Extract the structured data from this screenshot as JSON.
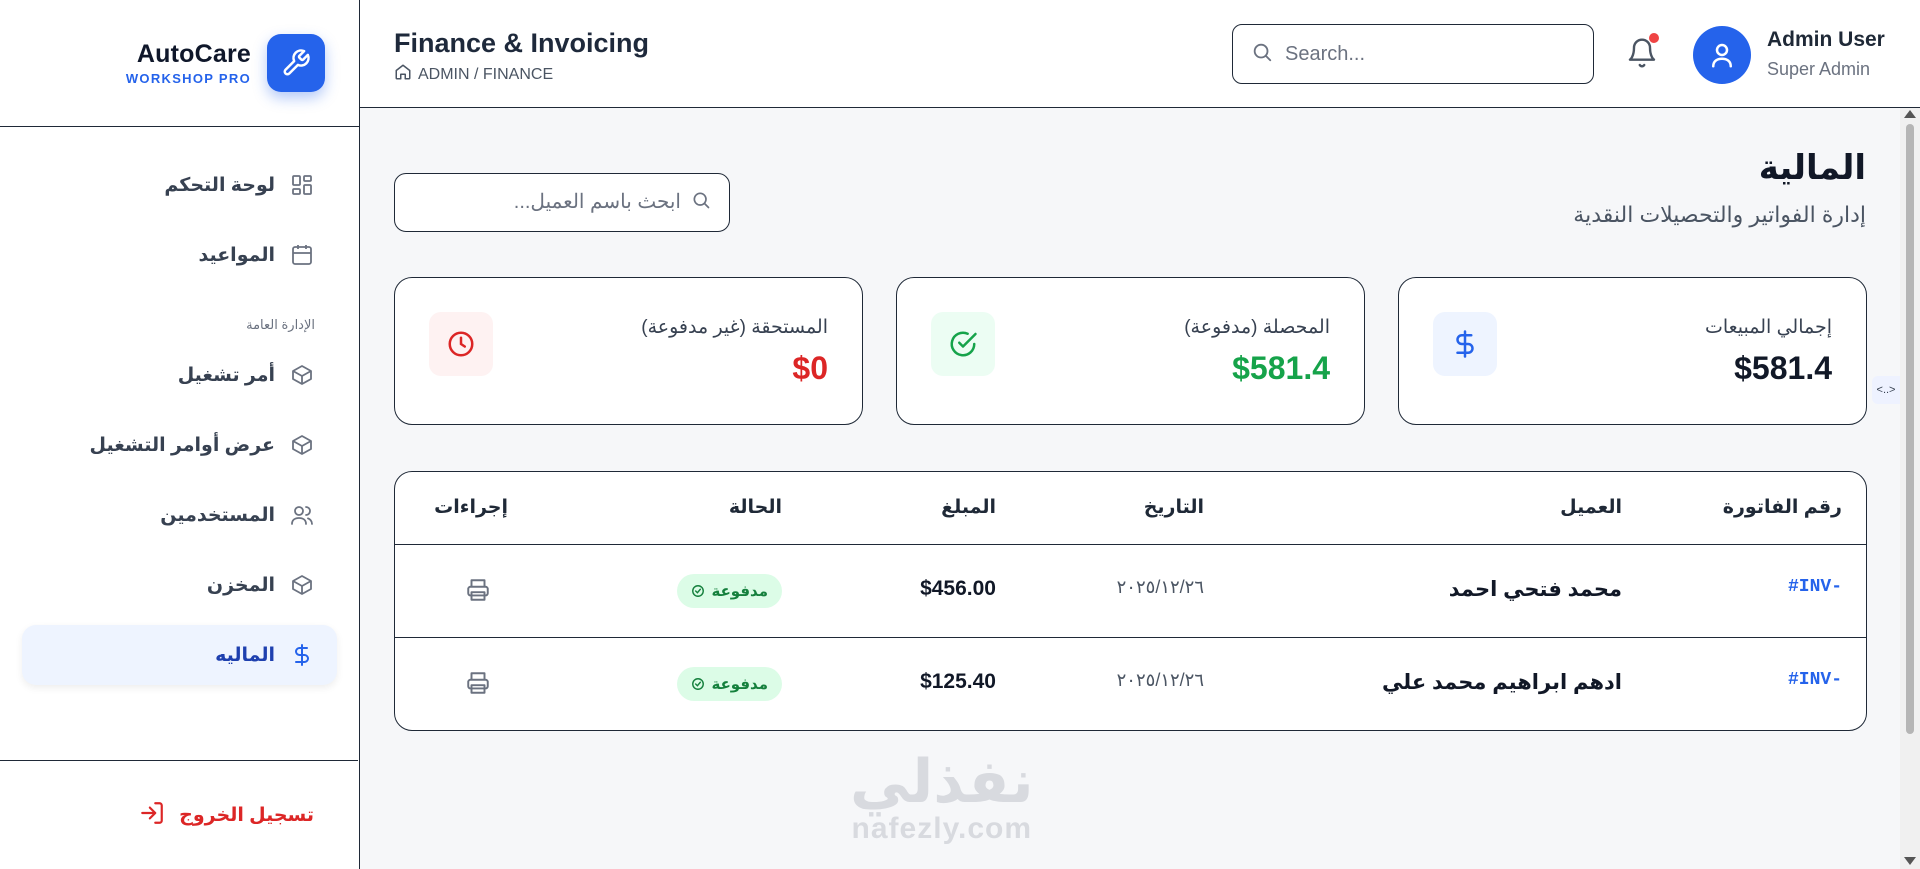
{
  "brand": {
    "name": "AutoCare",
    "subtitle": "WORKSHOP PRO"
  },
  "sidebar": {
    "items": [
      {
        "label": "لوحة التحكم",
        "icon": "dashboard-grid-icon"
      },
      {
        "label": "المواعيد",
        "icon": "calendar-icon"
      }
    ],
    "section_label": "الإدارة العامة",
    "section_items": [
      {
        "label": "أمر تشغيل",
        "icon": "package-icon"
      },
      {
        "label": "عرض أوامر التشغيل",
        "icon": "package-icon"
      },
      {
        "label": "المستخدمين",
        "icon": "users-icon"
      },
      {
        "label": "المخزن",
        "icon": "package-icon"
      },
      {
        "label": "الماليه",
        "icon": "dollar-icon",
        "active": true
      }
    ],
    "logout_label": "تسجيل الخروج"
  },
  "header": {
    "title": "Finance & Invoicing",
    "breadcrumb": "ADMIN / FINANCE",
    "search_placeholder": "Search...",
    "user_name": "Admin User",
    "user_role": "Super Admin"
  },
  "main": {
    "title": "المالية",
    "subtitle": "إدارة الفواتير والتحصيلات النقدية",
    "client_search_placeholder": "ابحث باسم العميل..."
  },
  "cards": [
    {
      "label": "إجمالي المبيعات",
      "value": "$581.4",
      "color": "#111827",
      "icon": "dollar-icon",
      "icon_bg": "#eef4ff",
      "icon_color": "#2563eb"
    },
    {
      "label": "المحصلة (مدفوعة)",
      "value": "$581.4",
      "color": "#16a34a",
      "icon": "check-circle-icon",
      "icon_bg": "#ecfdf3",
      "icon_color": "#16a34a"
    },
    {
      "label": "المستحقة (غير مدفوعة)",
      "value": "$0",
      "color": "#dc2626",
      "icon": "clock-icon",
      "icon_bg": "#fef2f2",
      "icon_color": "#dc2626"
    }
  ],
  "table": {
    "headers": {
      "invoice": "رقم الفاتورة",
      "client": "العميل",
      "date": "التاريخ",
      "amount": "المبلغ",
      "status": "الحالة",
      "actions": "إجراءات"
    },
    "rows": [
      {
        "invoice": "#INV-",
        "client": "محمد فتحي احمد",
        "date": "٢٠٢٥/١٢/٢٦",
        "amount": "$456.00",
        "status": "مدفوعة"
      },
      {
        "invoice": "#INV-",
        "client": "ادهم ابراهيم محمد علي",
        "date": "٢٠٢٥/١٢/٢٦",
        "amount": "$125.40",
        "status": "مدفوعة"
      }
    ]
  },
  "watermark": {
    "arabic": "نفذلي",
    "latin": "nafezly.com"
  },
  "edge_tab": "<..>"
}
